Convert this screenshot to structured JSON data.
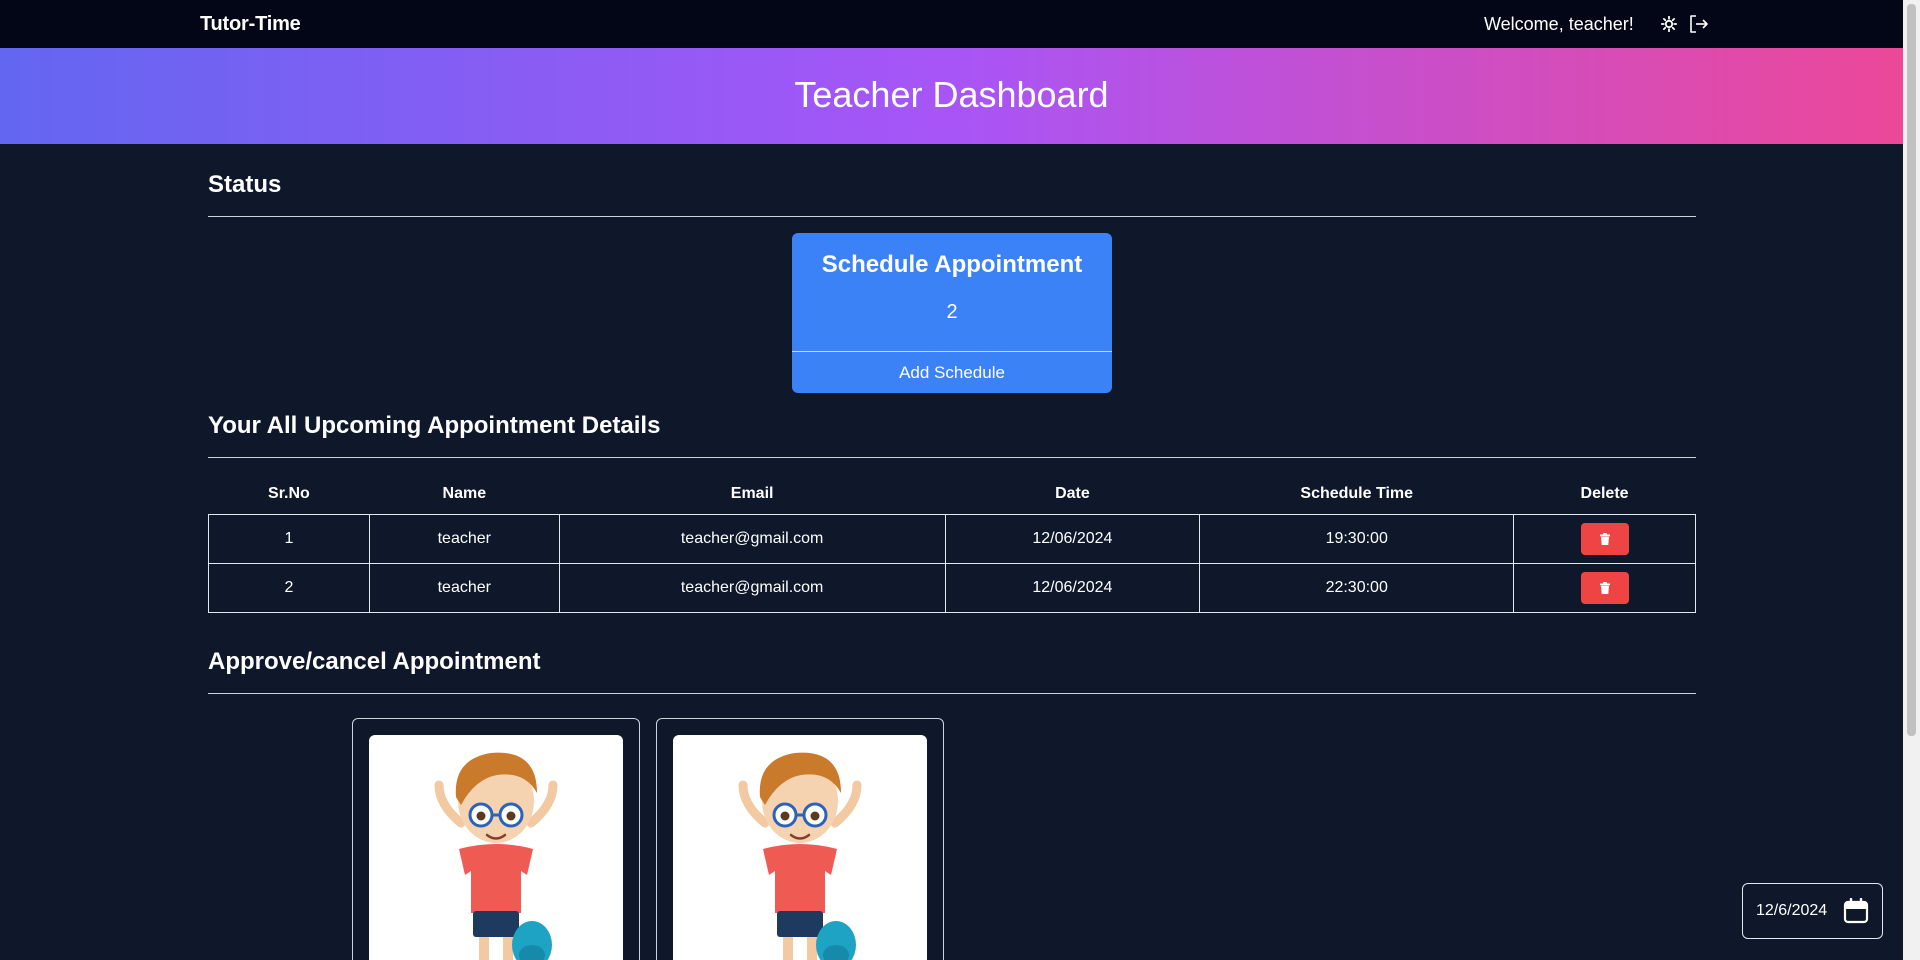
{
  "navbar": {
    "brand": "Tutor-Time",
    "welcome": "Welcome, teacher!",
    "icons": [
      "sun-icon",
      "logout-icon"
    ]
  },
  "hero": {
    "title": "Teacher Dashboard"
  },
  "status": {
    "heading": "Status",
    "card": {
      "title": "Schedule Appointment",
      "count": "2",
      "action_label": "Add Schedule"
    }
  },
  "appointments": {
    "heading": "Your All Upcoming Appointment Details",
    "columns": [
      "Sr.No",
      "Name",
      "Email",
      "Date",
      "Schedule Time",
      "Delete"
    ],
    "rows": [
      {
        "srno": "1",
        "name": "teacher",
        "email": "teacher@gmail.com",
        "date": "12/06/2024",
        "time": "19:30:00"
      },
      {
        "srno": "2",
        "name": "teacher",
        "email": "teacher@gmail.com",
        "date": "12/06/2024",
        "time": "22:30:00"
      }
    ]
  },
  "approve": {
    "heading": "Approve/cancel Appointment",
    "cards": [
      {
        "image": "student-boy-illustration"
      },
      {
        "image": "student-boy-illustration"
      }
    ]
  },
  "date_widget": {
    "value": "12/6/2024",
    "icon": "calendar-icon"
  },
  "colors": {
    "page_bg": "#0f172a",
    "navbar_bg": "#020617",
    "gradient": [
      "#6366f1",
      "#a855f7",
      "#ec4899"
    ],
    "card_blue": "#3b82f6",
    "delete_red": "#ef4444"
  }
}
